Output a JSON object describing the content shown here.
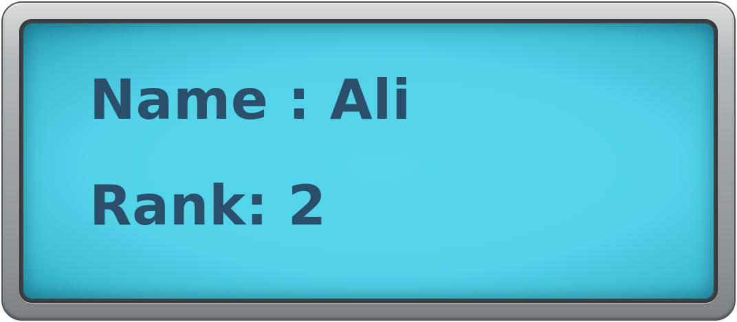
{
  "panel": {
    "name_text": "Name : Ali",
    "rank_text": "Rank: 2"
  },
  "colors": {
    "screen": "#52d3e8",
    "text": "#2b4f6b",
    "frame": "#a3a8ab"
  }
}
